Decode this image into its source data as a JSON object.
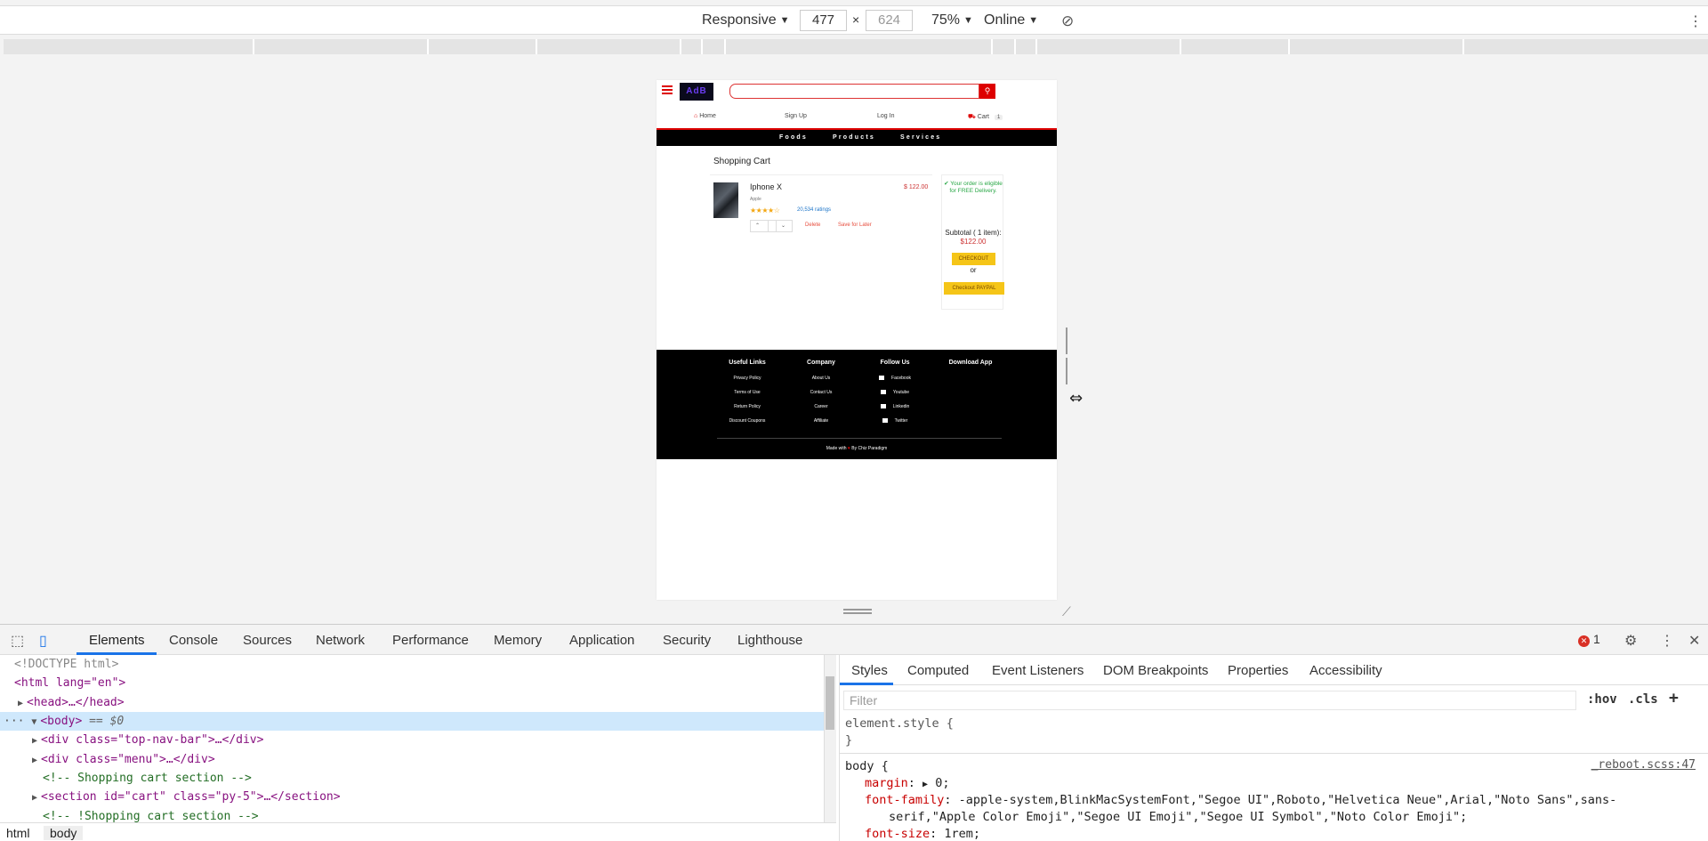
{
  "device_toolbar": {
    "device": "Responsive",
    "width": "477",
    "times": "×",
    "height": "624",
    "zoom": "75%",
    "network": "Online"
  },
  "site": {
    "logo_text": "AdB",
    "nav": {
      "home": "Home",
      "signup": "Sign Up",
      "login": "Log In",
      "cart": "Cart",
      "cart_count": "1"
    },
    "menu": [
      "Foods",
      "Products",
      "Services"
    ],
    "cart_title": "Shopping Cart",
    "item": {
      "name": "Iphone X",
      "price": "$ 122.00",
      "brand": "Apple",
      "stars": "★★★★☆",
      "ratings": "20,534 ratings",
      "delete": "Delete",
      "save_later": "Save for Later"
    },
    "summary": {
      "free_delivery": "✔ Your order is eligible for FREE Delivery.",
      "subtotal_label": "Subtotal ( 1 item):",
      "subtotal_amount": "$122.00",
      "checkout": "CHECKOUT",
      "or": "or",
      "paypal": "Checkout PAYPAL"
    },
    "footer": {
      "cols": [
        {
          "head": "Useful Links",
          "links": [
            "Privacy Policy",
            "Terms of Use",
            "Return Policy",
            "Discount Coupons"
          ]
        },
        {
          "head": "Company",
          "links": [
            "About Us",
            "Contact Us",
            "Career",
            "Affiliate"
          ]
        },
        {
          "head": "Follow Us",
          "links": [
            "Facebook",
            "Youtube",
            "Linkedin",
            "Twitter"
          ]
        },
        {
          "head": "Download App",
          "links": []
        }
      ],
      "made_with": "Made with",
      "by": "By Chiz Paradigm"
    }
  },
  "devtools": {
    "tabs": [
      "Elements",
      "Console",
      "Sources",
      "Network",
      "Performance",
      "Memory",
      "Application",
      "Security",
      "Lighthouse"
    ],
    "error_count": "1",
    "dom": {
      "doctype": "<!DOCTYPE html>",
      "html_open": "<html lang=\"en\">",
      "head": "<head>…</head>",
      "body_open": "<body>",
      "body_marker": "== $0",
      "topnav": "<div class=\"top-nav-bar\">…</div>",
      "menu": "<div class=\"menu\">…</div>",
      "comment1": "<!-- Shopping cart section  -->",
      "section": "<section id=\"cart\" class=\"py-5\">…</section>",
      "comment2": "<!-- !Shopping cart section  -->"
    },
    "breadcrumbs": [
      "html",
      "body"
    ],
    "styles_tabs": [
      "Styles",
      "Computed",
      "Event Listeners",
      "DOM Breakpoints",
      "Properties",
      "Accessibility"
    ],
    "filter_placeholder": "Filter",
    "hov": ":hov",
    "cls": ".cls",
    "plus": "+",
    "element_style": "element.style {",
    "close_brace": "}",
    "body_rule": "body {",
    "source": "_reboot.scss:47",
    "margin": "margin",
    "margin_val": "0;",
    "font_family": "font-family",
    "font_family_val1": "-apple-system,BlinkMacSystemFont,\"Segoe UI\",Roboto,\"Helvetica Neue\",Arial,\"Noto Sans\",sans-",
    "font_family_val2": "serif,\"Apple Color Emoji\",\"Segoe UI Emoji\",\"Segoe UI Symbol\",\"Noto Color Emoji\";",
    "font_size": "font-size",
    "font_size_val": "1rem;"
  }
}
